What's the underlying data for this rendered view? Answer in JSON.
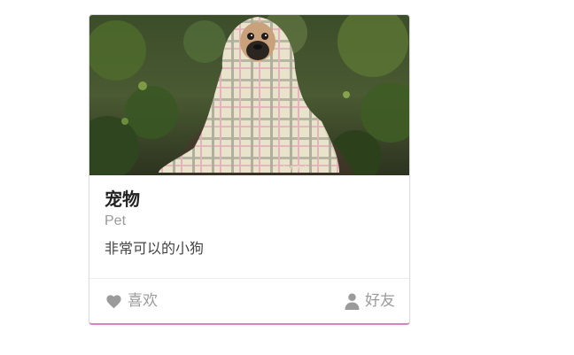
{
  "card": {
    "title": "宠物",
    "subtitle": "Pet",
    "description": "非常可以的小狗",
    "image_icon": "photo-pug-in-plaid-blanket",
    "accent_color": "#d386bd",
    "footer": {
      "like": {
        "icon": "heart-icon",
        "label": "喜欢"
      },
      "friends": {
        "icon": "user-icon",
        "label": "好友"
      }
    }
  }
}
